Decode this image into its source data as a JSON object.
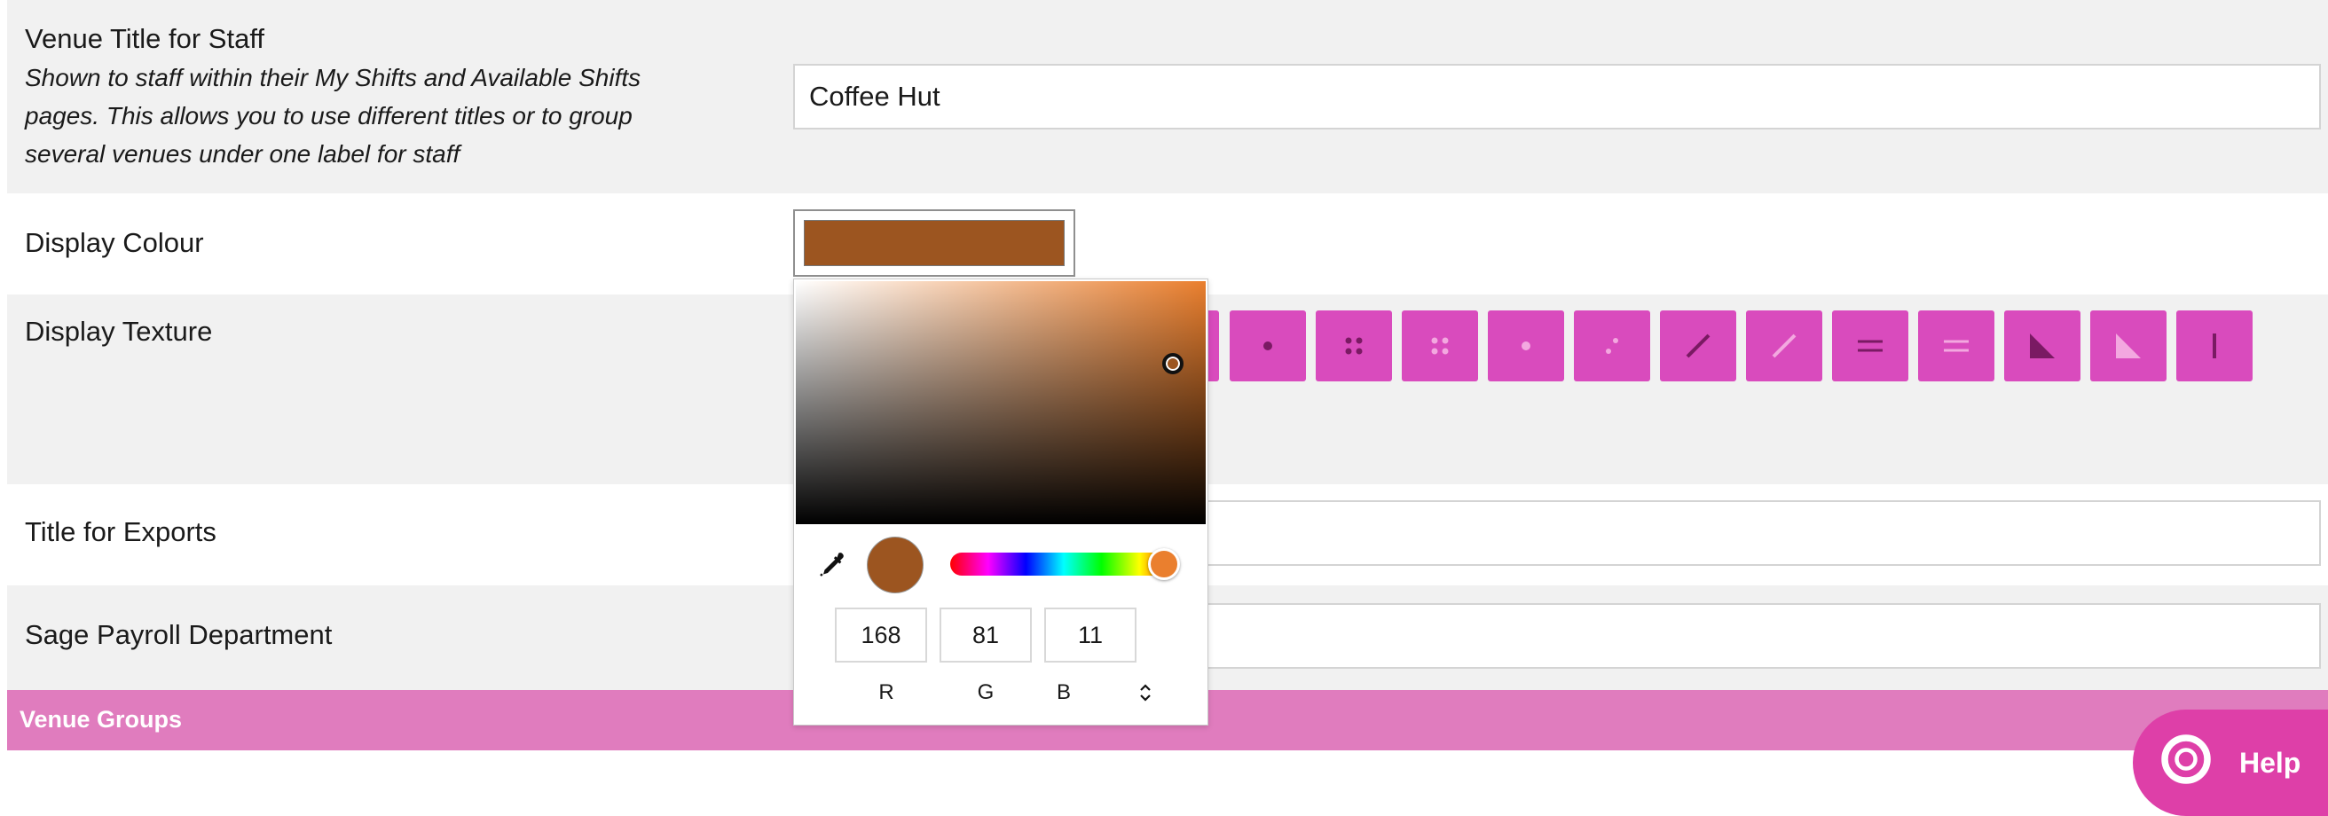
{
  "venue_title_row": {
    "label": "Venue Title for Staff",
    "help": "Shown to staff within their My Shifts and Available Shifts pages. This allows you to use different titles or to group several venues under one label for staff",
    "value": "Coffee Hut"
  },
  "display_colour_row": {
    "label": "Display Colour",
    "swatch_color": "#9C5520"
  },
  "display_texture_row": {
    "label": "Display Texture",
    "button_color": "#d94bbd",
    "textures": [
      "dot-icon",
      "four-dots-icon",
      "four-dots-light-icon",
      "dot-light-icon",
      "two-dots-icon",
      "diagonal-line-icon",
      "diagonal-line-light-icon",
      "double-line-icon",
      "double-line-light-icon",
      "triangle-icon",
      "triangle-light-icon",
      "vertical-line-icon"
    ]
  },
  "title_for_exports_row": {
    "label": "Title for Exports",
    "value": ""
  },
  "sage_row": {
    "label": "Sage Payroll Department",
    "value": ""
  },
  "color_picker": {
    "hue_color": "#ea7f2e",
    "current_color": "#9C5520",
    "saturation_percent": 92,
    "brightness_percent": 66,
    "hue_position_percent": 94,
    "rgb": {
      "r": "168",
      "g": "81",
      "b": "11",
      "r_label": "R",
      "g_label": "G",
      "b_label": "B"
    }
  },
  "venue_groups": {
    "title": "Venue Groups"
  },
  "help_button": {
    "label": "Help",
    "color": "#de3fa8"
  }
}
